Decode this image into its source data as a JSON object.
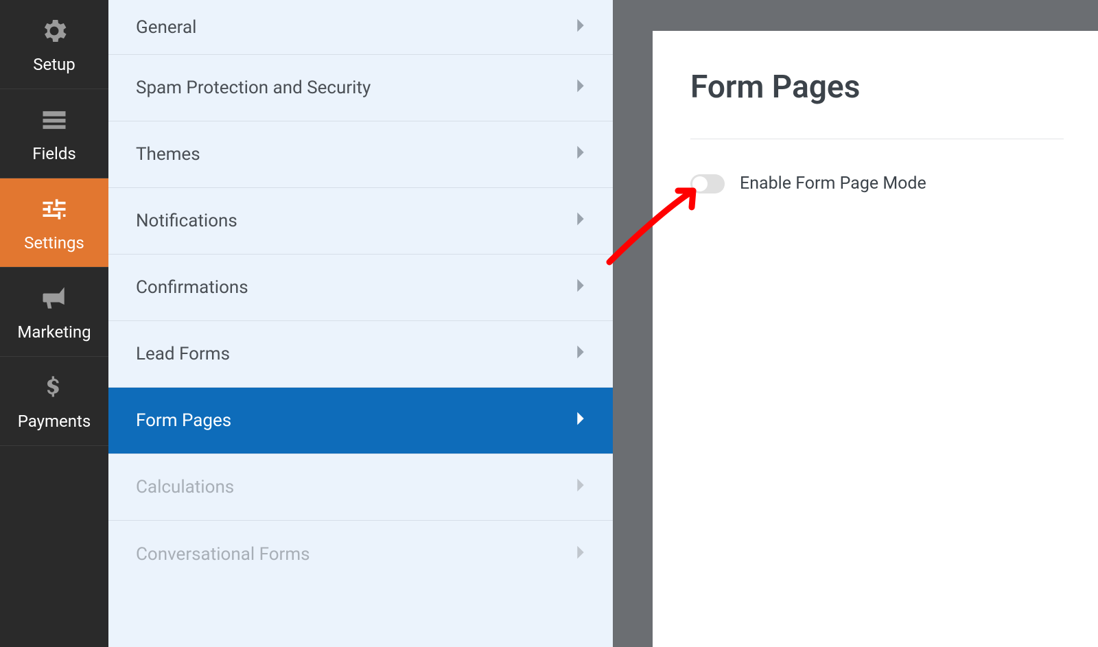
{
  "sidebar": {
    "items": [
      {
        "label": "Setup"
      },
      {
        "label": "Fields"
      },
      {
        "label": "Settings"
      },
      {
        "label": "Marketing"
      },
      {
        "label": "Payments"
      }
    ]
  },
  "settings": {
    "items": [
      {
        "label": "General"
      },
      {
        "label": "Spam Protection and Security"
      },
      {
        "label": "Themes"
      },
      {
        "label": "Notifications"
      },
      {
        "label": "Confirmations"
      },
      {
        "label": "Lead Forms"
      },
      {
        "label": "Form Pages"
      },
      {
        "label": "Calculations"
      },
      {
        "label": "Conversational Forms"
      }
    ]
  },
  "content": {
    "title": "Form Pages",
    "toggle_label": "Enable Form Page Mode"
  }
}
